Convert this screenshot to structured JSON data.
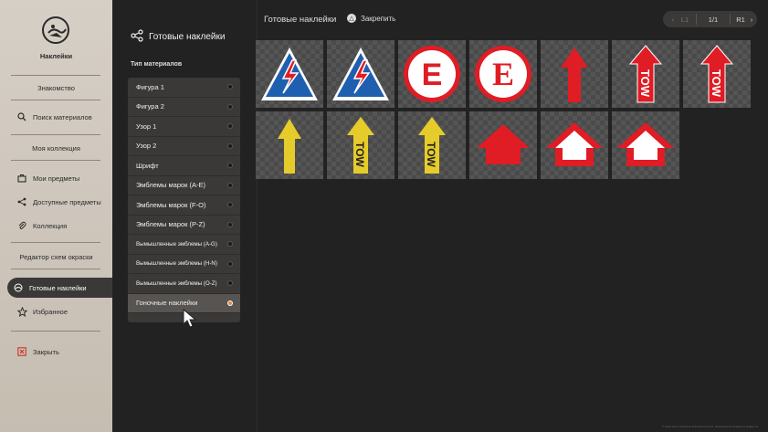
{
  "sidebar": {
    "app_label": "Наклейки",
    "sections": {
      "intro": "Знакомство",
      "collection": "Моя коллекция",
      "editor": "Редактор схем окраски"
    },
    "items": {
      "search": "Поиск материалов",
      "my_items": "Мои предметы",
      "available": "Доступные предметы",
      "collection": "Коллекция",
      "ready": "Готовые наклейки",
      "favorites": "Избранное",
      "close": "Закрыть"
    }
  },
  "panel": {
    "title": "Готовые наклейки",
    "material_type_label": "Тип материалов",
    "categories": [
      {
        "label": "Фигура 1",
        "small": false,
        "active": false
      },
      {
        "label": "Фигура 2",
        "small": false,
        "active": false
      },
      {
        "label": "Узор 1",
        "small": false,
        "active": false
      },
      {
        "label": "Узор 2",
        "small": false,
        "active": false
      },
      {
        "label": "Шрифт",
        "small": false,
        "active": false
      },
      {
        "label": "Эмблемы марок (A-E)",
        "small": false,
        "active": false
      },
      {
        "label": "Эмблемы марок (F-O)",
        "small": false,
        "active": false
      },
      {
        "label": "Эмблемы марок (P-Z)",
        "small": false,
        "active": false
      },
      {
        "label": "Вымышленные эмблемы (A-G)",
        "small": true,
        "active": false
      },
      {
        "label": "Вымышленные эмблемы (H-N)",
        "small": true,
        "active": false
      },
      {
        "label": "Вымышленные эмблемы (O-Z)",
        "small": true,
        "active": false
      },
      {
        "label": "Гоночные наклейки",
        "small": false,
        "active": true
      }
    ]
  },
  "topbar": {
    "title": "Готовые наклейки",
    "pin_label": "Закрепить",
    "pin_button_glyph": "△",
    "pager": {
      "prev": "L1",
      "page": "1/1",
      "next": "R1"
    }
  },
  "stickers": [
    {
      "name": "sticker-lightning-warning-1",
      "kind": "lightning"
    },
    {
      "name": "sticker-lightning-warning-2",
      "kind": "lightning"
    },
    {
      "name": "sticker-e-circle-1",
      "kind": "e_sans"
    },
    {
      "name": "sticker-e-circle-2",
      "kind": "e_serif"
    },
    {
      "name": "sticker-red-arrow",
      "kind": "arrow_red"
    },
    {
      "name": "sticker-red-tow-arrow-1",
      "kind": "tow_red",
      "text": "TOW"
    },
    {
      "name": "sticker-red-tow-arrow-2",
      "kind": "tow_red",
      "text": "TOW"
    },
    {
      "name": "sticker-yellow-arrow",
      "kind": "arrow_yellow"
    },
    {
      "name": "sticker-yellow-tow-arrow-1",
      "kind": "tow_yellow",
      "text": "TOW"
    },
    {
      "name": "sticker-yellow-tow-arrow-2",
      "kind": "tow_yellow",
      "text": "TOW"
    },
    {
      "name": "sticker-red-chevron",
      "kind": "chev_red"
    },
    {
      "name": "sticker-red-white-chevron-1",
      "kind": "chev_rw"
    },
    {
      "name": "sticker-red-white-chevron-2",
      "kind": "chev_rw"
    }
  ],
  "footer": "© 2021 Sony Interactive Entertainment Inc. Developed by Polyphony Digital Inc.",
  "colors": {
    "accent": "#e88a3a",
    "sidebar_bg": "#d6cfc6",
    "active_nav": "#3b3937",
    "red": "#e01c24",
    "yellow": "#e6cc2a"
  }
}
